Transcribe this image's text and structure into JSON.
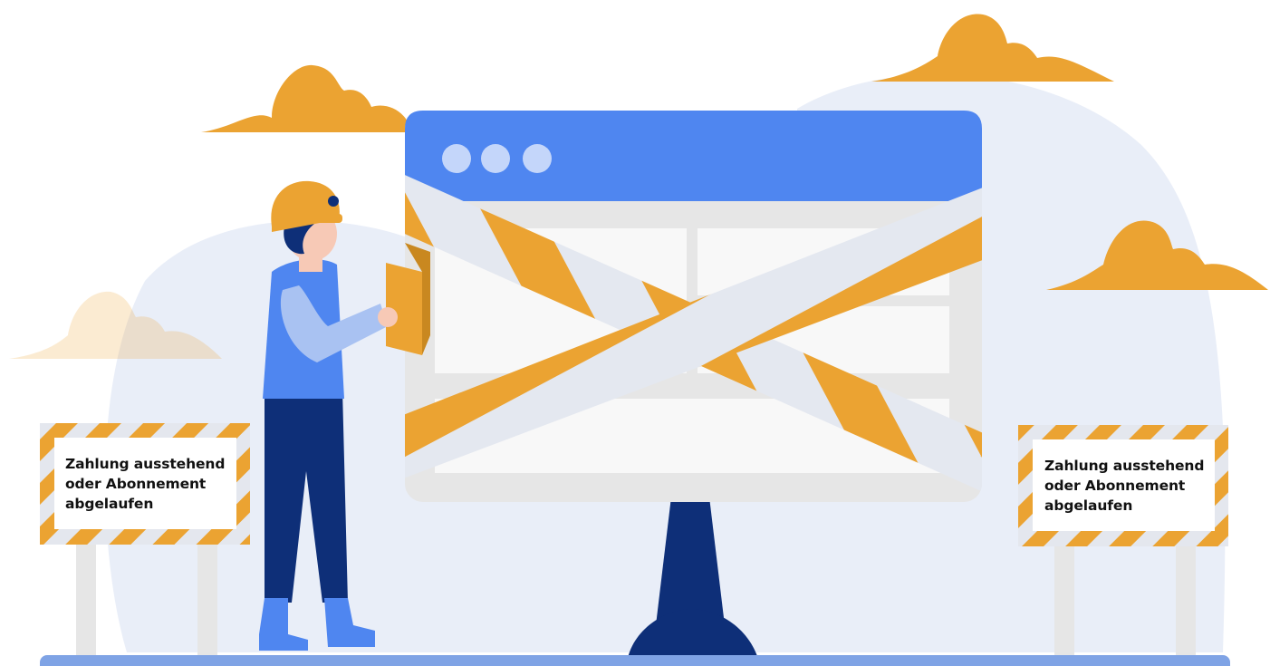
{
  "signs": [
    {
      "lines": [
        "Zahlung ausstehend",
        "oder Abonnement",
        "abgelaufen"
      ]
    },
    {
      "lines": [
        "Zahlung ausstehend",
        "oder Abonnement",
        "abgelaufen"
      ]
    }
  ],
  "colors": {
    "accent_orange": "#EBA332",
    "browser_blue": "#4F86F0",
    "navy": "#0E2F78",
    "background_blob": "#E9EEF8",
    "ground_bar": "#7FA3E5"
  },
  "icons": [
    "cloud",
    "hard-hat-worker",
    "browser-window",
    "caution-tape",
    "barrier-sign"
  ]
}
